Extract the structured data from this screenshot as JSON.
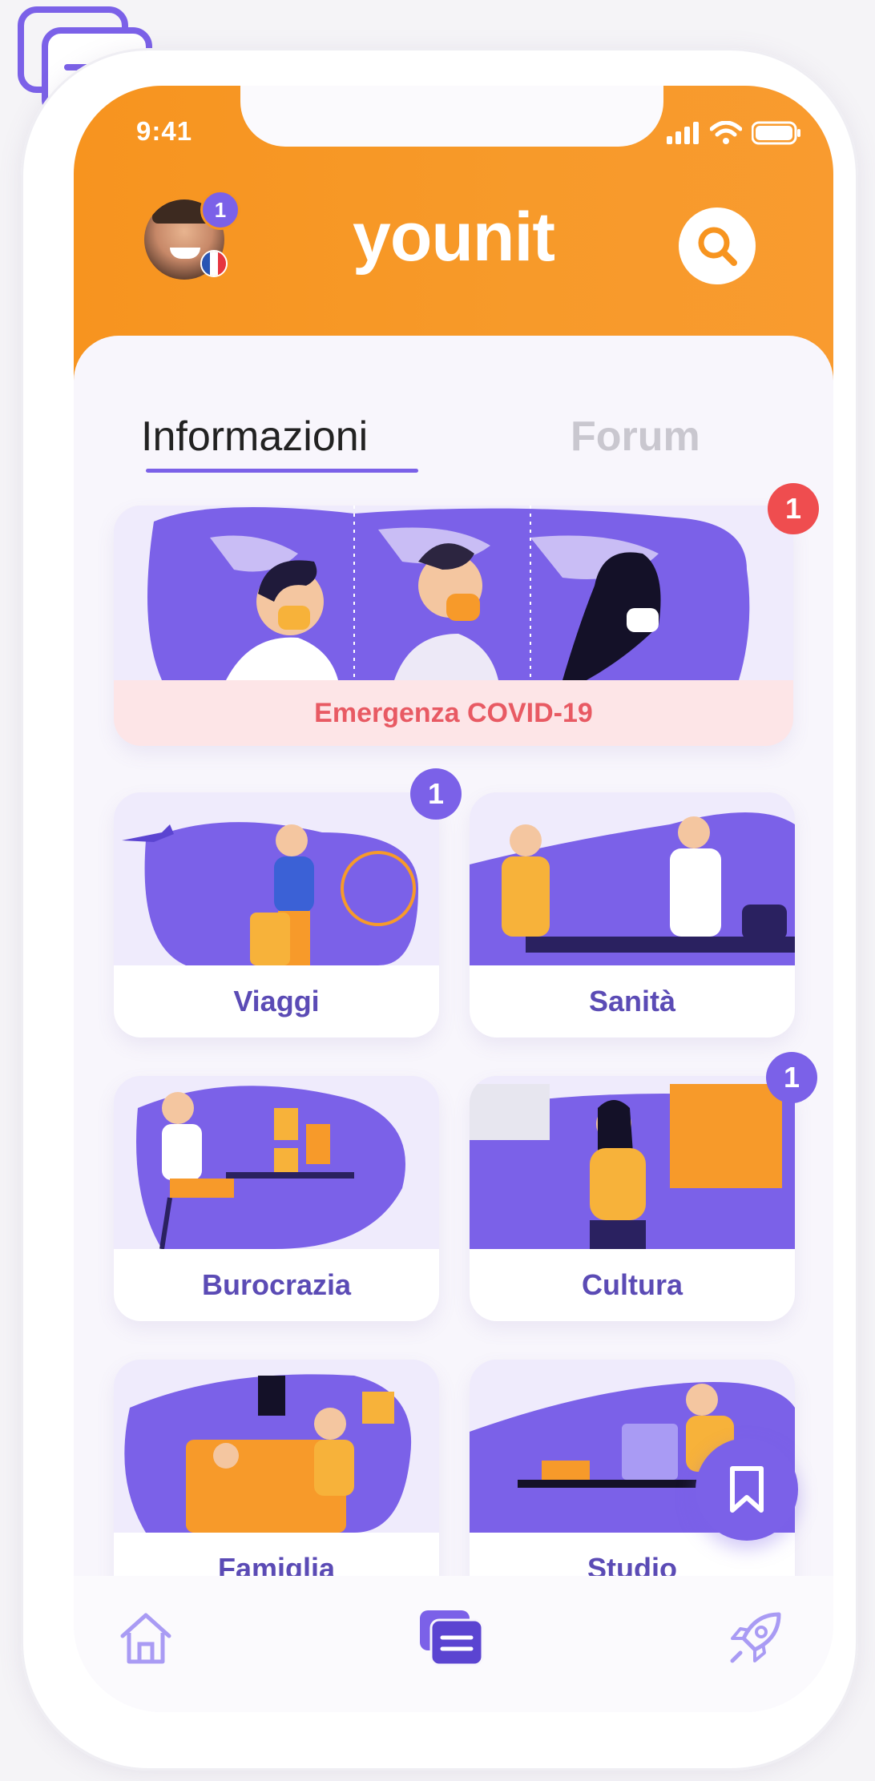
{
  "status_bar": {
    "time": "9:41"
  },
  "header": {
    "brand": "younit",
    "avatar_badge": "1"
  },
  "tabs": [
    {
      "label": "Informazioni",
      "active": true
    },
    {
      "label": "Forum",
      "active": false
    }
  ],
  "featured": {
    "label": "Emergenza COVID-19",
    "badge": "1"
  },
  "categories": [
    {
      "label": "Viaggi",
      "badge": "1"
    },
    {
      "label": "Sanità",
      "badge": ""
    },
    {
      "label": "Burocrazia",
      "badge": ""
    },
    {
      "label": "Cultura",
      "badge": "1"
    },
    {
      "label": "Famiglia",
      "badge": ""
    },
    {
      "label": "Studio",
      "badge": ""
    }
  ],
  "bottom_nav": [
    {
      "icon": "home-icon",
      "active": false
    },
    {
      "icon": "cards-icon",
      "active": true
    },
    {
      "icon": "rocket-icon",
      "active": false
    }
  ],
  "colors": {
    "header_orange": "#f7941f",
    "accent_purple": "#7b61e8",
    "alert_red": "#ef4d4f",
    "covid_label": "#e85a63"
  }
}
